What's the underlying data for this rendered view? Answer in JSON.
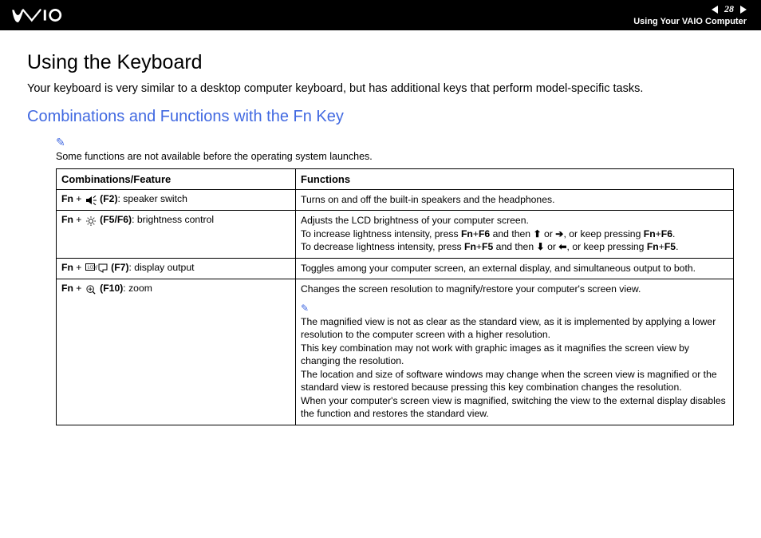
{
  "header": {
    "page_number": "28",
    "section": "Using Your VAIO Computer"
  },
  "title": "Using the Keyboard",
  "intro": "Your keyboard is very similar to a desktop computer keyboard, but has additional keys that perform model-specific tasks.",
  "subheading": "Combinations and Functions with the Fn Key",
  "top_note": "Some functions are not available before the operating system launches.",
  "table": {
    "head": {
      "col1": "Combinations/Feature",
      "col2": "Functions"
    },
    "rows": [
      {
        "combo_prefix": "Fn",
        "combo_key": "(F2)",
        "combo_label": ": speaker switch",
        "combo_icon": "speaker",
        "func_lines": [
          "Turns on and off the built-in speakers and the headphones."
        ]
      },
      {
        "combo_prefix": "Fn",
        "combo_key": "(F5/F6)",
        "combo_label": ": brightness control",
        "combo_icon": "brightness",
        "func_lines": [
          "Adjusts the LCD brightness of your computer screen.",
          "To increase lightness intensity, press Fn+F6 and then ↑ or →, or keep pressing Fn+F6.",
          "To decrease lightness intensity, press Fn+F5 and then ↓ or ←, or keep pressing Fn+F5."
        ],
        "bold_map": {
          "Fn": true,
          "F6": true,
          "F5": true
        }
      },
      {
        "combo_prefix": "Fn",
        "combo_key": "(F7)",
        "combo_label": ": display output",
        "combo_icon": "display",
        "func_lines": [
          "Toggles among your computer screen, an external display, and simultaneous output to both."
        ]
      },
      {
        "combo_prefix": "Fn",
        "combo_key": "(F10)",
        "combo_label": ": zoom",
        "combo_icon": "zoom",
        "func_lines": [
          "Changes the screen resolution to magnify/restore your computer's screen view."
        ],
        "note_lines": [
          "The magnified view is not as clear as the standard view, as it is implemented by applying a lower resolution to the computer screen with a higher resolution.",
          "This key combination may not work with graphic images as it magnifies the screen view by changing the resolution.",
          "The location and size of software windows may change when the screen view is magnified or the standard view is restored because pressing this key combination changes the resolution.",
          "When your computer's screen view is magnified, switching the view to the external display disables the function and restores the standard view."
        ]
      }
    ]
  }
}
